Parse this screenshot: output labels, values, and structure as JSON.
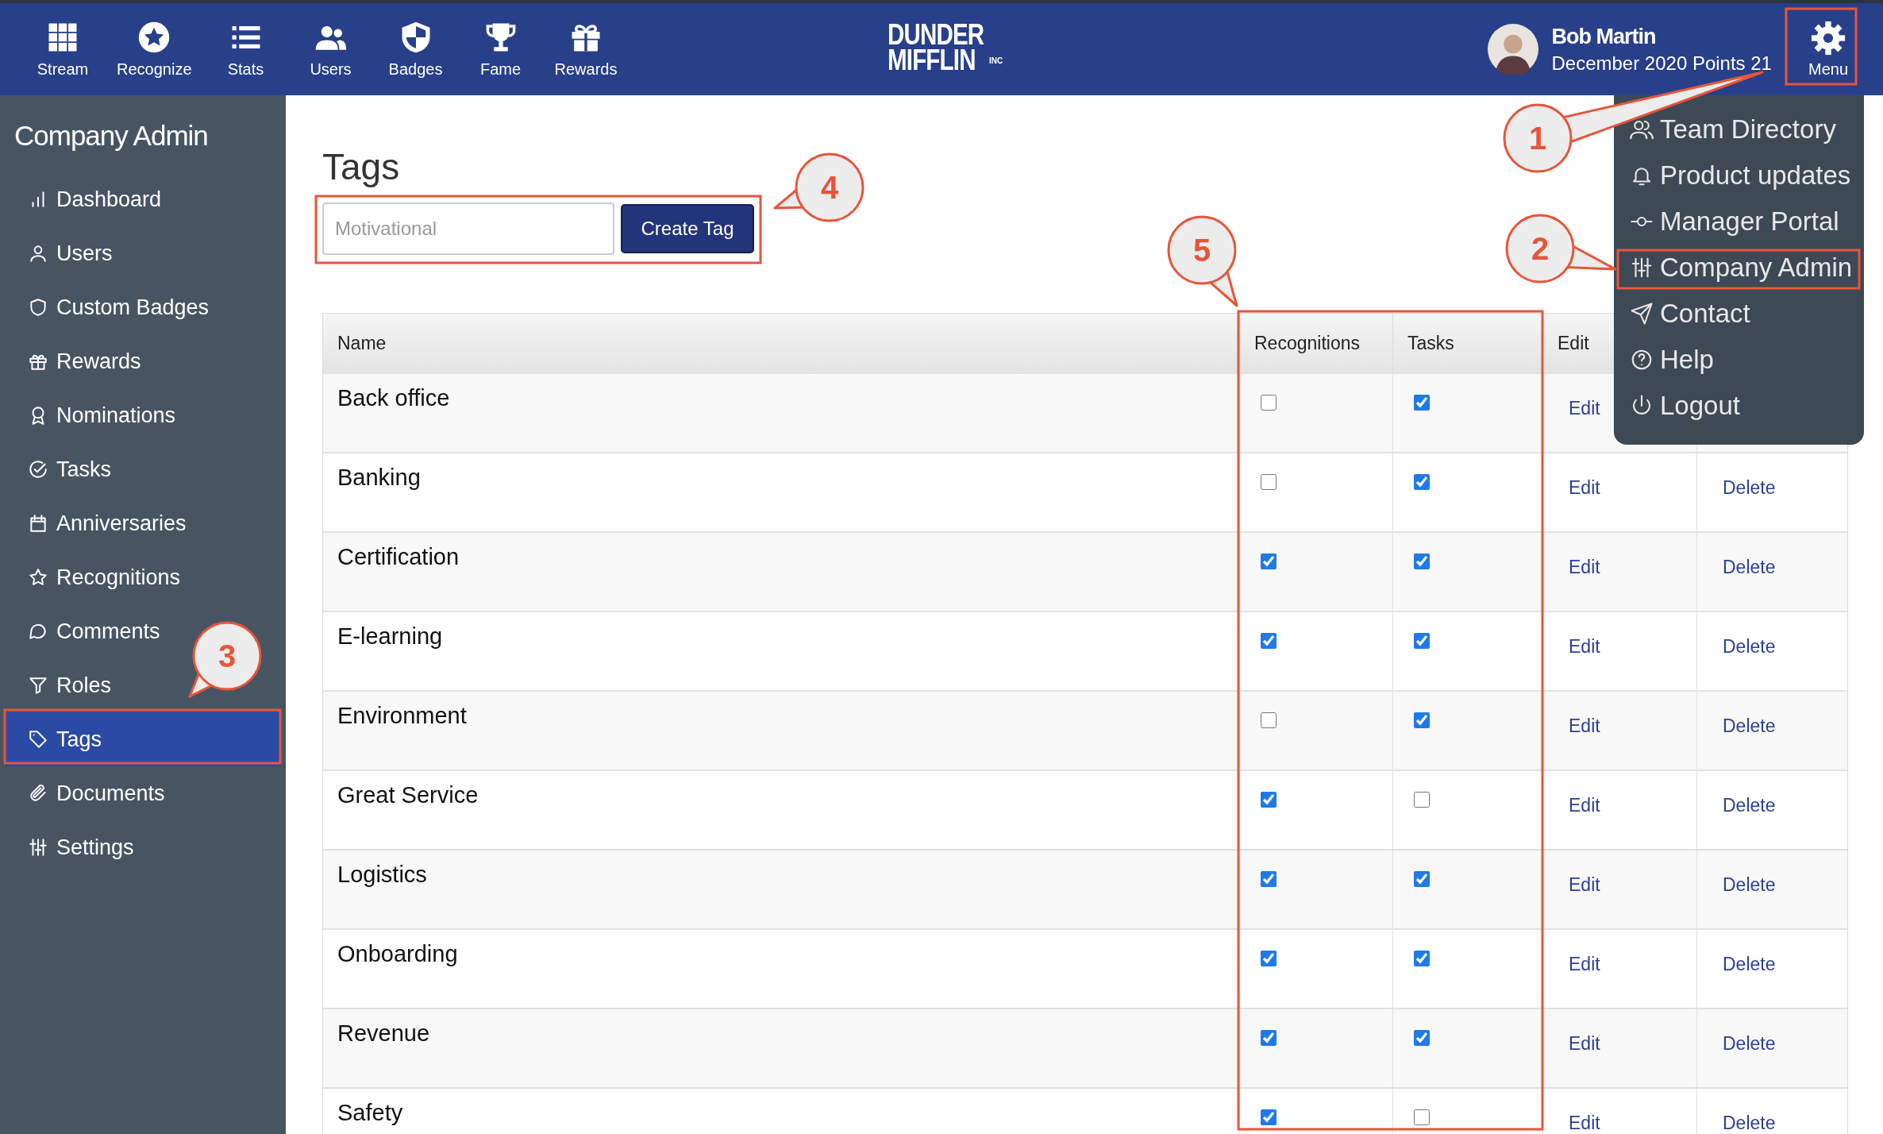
{
  "nav": [
    {
      "label": "Stream",
      "kind": "grid"
    },
    {
      "label": "Recognize",
      "kind": "star"
    },
    {
      "label": "Stats",
      "kind": "list"
    },
    {
      "label": "Users",
      "kind": "users"
    },
    {
      "label": "Badges",
      "kind": "shield"
    },
    {
      "label": "Fame",
      "kind": "trophy"
    },
    {
      "label": "Rewards",
      "kind": "gift"
    }
  ],
  "logo": {
    "line1": "DUNDER",
    "line2": "MIFFLIN",
    "suffix": "INC"
  },
  "user": {
    "name": "Bob Martin",
    "subtitle": "December 2020 Points 21"
  },
  "menu_button": {
    "label": "Menu"
  },
  "menu": {
    "items": [
      {
        "label": "Team Directory",
        "kind": "people"
      },
      {
        "label": "Product updates",
        "kind": "bell"
      },
      {
        "label": "Manager Portal",
        "kind": "commit"
      },
      {
        "label": "Company Admin",
        "kind": "sliders"
      },
      {
        "label": "Contact",
        "kind": "send"
      },
      {
        "label": "Help",
        "kind": "help"
      },
      {
        "label": "Logout",
        "kind": "power"
      }
    ]
  },
  "sidebar": {
    "title": "Company Admin",
    "items": [
      {
        "label": "Dashboard",
        "kind": "bars",
        "selected": false
      },
      {
        "label": "Users",
        "kind": "user",
        "selected": false
      },
      {
        "label": "Custom Badges",
        "kind": "shield",
        "selected": false
      },
      {
        "label": "Rewards",
        "kind": "gift",
        "selected": false
      },
      {
        "label": "Nominations",
        "kind": "award",
        "selected": false
      },
      {
        "label": "Tasks",
        "kind": "check",
        "selected": false
      },
      {
        "label": "Anniversaries",
        "kind": "calendar",
        "selected": false
      },
      {
        "label": "Recognitions",
        "kind": "star",
        "selected": false
      },
      {
        "label": "Comments",
        "kind": "comment",
        "selected": false
      },
      {
        "label": "Roles",
        "kind": "filter",
        "selected": false
      },
      {
        "label": "Tags",
        "kind": "tag",
        "selected": true
      },
      {
        "label": "Documents",
        "kind": "paperclip",
        "selected": false
      },
      {
        "label": "Settings",
        "kind": "sliders",
        "selected": false
      }
    ]
  },
  "page": {
    "title": "Tags",
    "tag_input": {
      "placeholder": "Motivational"
    },
    "create_button": "Create Tag"
  },
  "table": {
    "columns": [
      "Name",
      "Recognitions",
      "Tasks",
      "Edit"
    ],
    "rows": [
      {
        "name": "Back office",
        "recognitions": false,
        "tasks": true,
        "edit": "Edit"
      },
      {
        "name": "Banking",
        "recognitions": false,
        "tasks": true,
        "edit": "Edit",
        "delete": "Delete"
      },
      {
        "name": "Certification",
        "recognitions": true,
        "tasks": true,
        "edit": "Edit",
        "delete": "Delete"
      },
      {
        "name": "E-learning",
        "recognitions": true,
        "tasks": true,
        "edit": "Edit",
        "delete": "Delete"
      },
      {
        "name": "Environment",
        "recognitions": false,
        "tasks": true,
        "edit": "Edit",
        "delete": "Delete"
      },
      {
        "name": "Great Service",
        "recognitions": true,
        "tasks": false,
        "edit": "Edit",
        "delete": "Delete"
      },
      {
        "name": "Logistics",
        "recognitions": true,
        "tasks": true,
        "edit": "Edit",
        "delete": "Delete"
      },
      {
        "name": "Onboarding",
        "recognitions": true,
        "tasks": true,
        "edit": "Edit",
        "delete": "Delete"
      },
      {
        "name": "Revenue",
        "recognitions": true,
        "tasks": true,
        "edit": "Edit",
        "delete": "Delete"
      },
      {
        "name": "Safety",
        "recognitions": true,
        "tasks": false,
        "edit": "Edit",
        "delete": "Delete"
      }
    ]
  },
  "callouts": [
    {
      "number": "1"
    },
    {
      "number": "2"
    },
    {
      "number": "3"
    },
    {
      "number": "4"
    },
    {
      "number": "5"
    }
  ]
}
